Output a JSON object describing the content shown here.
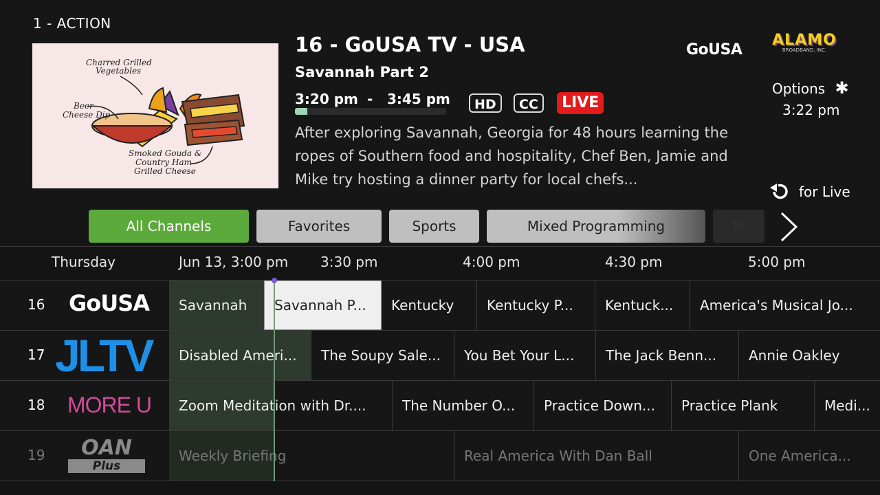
{
  "header": {
    "category": "1 - ACTION",
    "program_title": "16 - GoUSA TV - USA",
    "episode_title": "Savannah Part 2",
    "start_time": "3:20 pm",
    "time_sep": "-",
    "end_time": "3:45 pm",
    "progress_fraction": 0.08,
    "badges": {
      "hd": "HD",
      "cc": "CC",
      "live": "LIVE"
    },
    "description": "After exploring Savannah, Georgia for 48 hours learning the ropes of Southern food and hospitality, Chef Ben, Jamie and Mike try hosting a dinner party for local chefs...",
    "network_logo": "GoUSA",
    "provider_logo_main": "ALAMO",
    "provider_logo_sub": "BROADBAND, INC.",
    "options_label": "Options",
    "clock": "3:22 pm",
    "replay_label": "for  Live"
  },
  "thumbnail": {
    "label_vegetables": [
      "Charred Grilled",
      "Vegetables"
    ],
    "label_dip": [
      "Beer",
      "Cheese Dip"
    ],
    "label_cheese": [
      "Smoked Gouda &",
      "Country Ham",
      "Grilled Cheese"
    ]
  },
  "filters": [
    {
      "label": "All Channels"
    },
    {
      "label": "Favorites"
    },
    {
      "label": "Sports"
    },
    {
      "label": "Mixed Programming"
    },
    {
      "label": "M"
    }
  ],
  "timebar": {
    "day": "Thursday",
    "slots": [
      "Jun 13, 3:00 pm",
      "3:30 pm",
      "4:00 pm",
      "4:30 pm",
      "5:00 pm"
    ]
  },
  "channels": [
    {
      "number": "16",
      "logo": "GoUSA",
      "programs": [
        "Savannah",
        "Savannah P...",
        "Kentucky",
        "Kentucky P...",
        "Kentuck...",
        "America's Musical Jo..."
      ]
    },
    {
      "number": "17",
      "logo": "JLTV",
      "programs": [
        "Disabled Ameri...",
        "The Soupy Sale...",
        "You Bet Your L...",
        "The Jack Benn...",
        "Annie Oakley"
      ]
    },
    {
      "number": "18",
      "logo": "MORE U",
      "programs": [
        "Zoom Meditation with Dr....",
        "The Number O...",
        "Practice Down...",
        "Practice Plank",
        "Medi..."
      ]
    },
    {
      "number": "19",
      "logo_main": "OAN",
      "logo_sub": "Plus",
      "programs": [
        "Weekly Briefing",
        "Real America With Dan Ball",
        "One America..."
      ]
    }
  ],
  "colors": {
    "accent_green": "#5ca93c",
    "live_red": "#e31b1b",
    "progress": "#9ed6b9",
    "jltv_blue": "#1e90e8",
    "moreu_pink": "#d24a9b"
  }
}
